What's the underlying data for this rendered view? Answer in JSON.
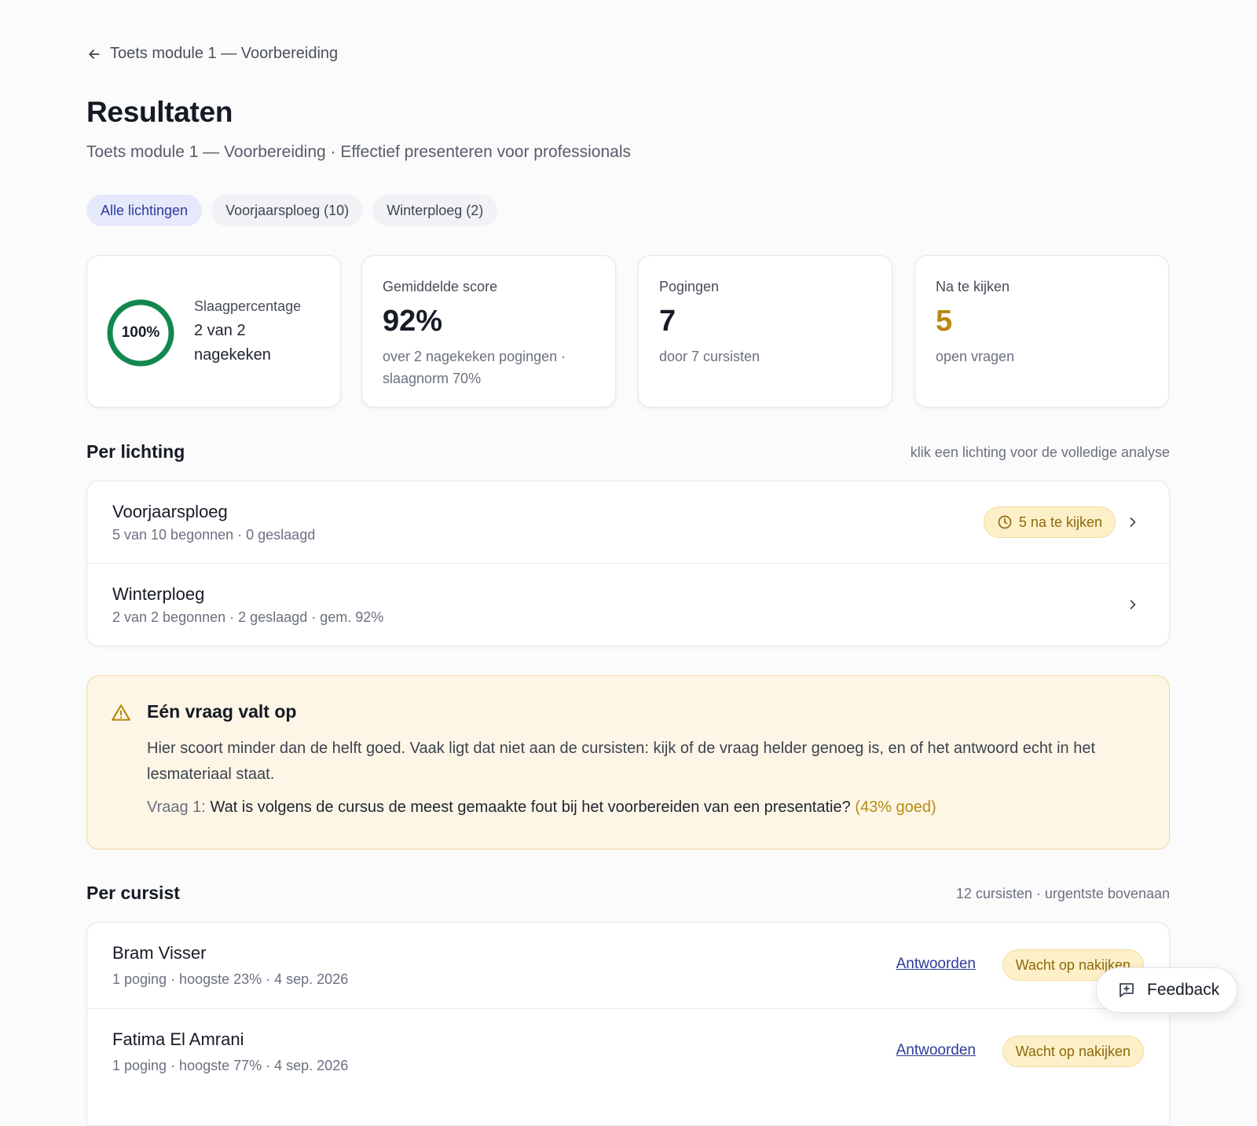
{
  "nav": {
    "back_label": "Toets module 1 — Voorbereiding"
  },
  "header": {
    "title": "Resultaten",
    "subtitle": "Toets module 1 — Voorbereiding · Effectief presenteren voor professionals"
  },
  "filters": [
    {
      "label": "Alle lichtingen",
      "active": true
    },
    {
      "label": "Voorjaarsploeg (10)",
      "active": false
    },
    {
      "label": "Winterploeg (2)",
      "active": false
    }
  ],
  "stats": {
    "pass": {
      "ring_label": "100%",
      "pass_fraction": 1.0,
      "label": "Slaagpercentage",
      "detail": "2 van 2 nagekeken"
    },
    "avg": {
      "label": "Gemiddelde score",
      "value": "92%",
      "desc": "over 2 nagekeken pogingen · slaagnorm 70%"
    },
    "attempts": {
      "label": "Pogingen",
      "value": "7",
      "desc": "door 7 cursisten"
    },
    "review": {
      "label": "Na te kijken",
      "value": "5",
      "desc": "open vragen"
    }
  },
  "cohorts": {
    "title": "Per lichting",
    "hint": "klik een lichting voor de volledige analyse",
    "items": [
      {
        "name": "Voorjaarsploeg",
        "meta": "5 van 10 begonnen · 0 geslaagd",
        "badge": "5 na te kijken"
      },
      {
        "name": "Winterploeg",
        "meta": "2 van 2 begonnen · 2 geslaagd · gem. 92%"
      }
    ]
  },
  "alert": {
    "title": "Eén vraag valt op",
    "body": "Hier scoort minder dan de helft goed. Vaak ligt dat niet aan de cursisten: kijk of de vraag helder genoeg is, en of het antwoord echt in het lesmateriaal staat.",
    "question_label": "Vraag 1:",
    "question_text": "Wat is volgens de cursus de meest gemaakte fout bij het voorbereiden van een presentatie?",
    "question_pct": "(43% goed)"
  },
  "students": {
    "title": "Per cursist",
    "hint": "12 cursisten · urgentste bovenaan",
    "items": [
      {
        "name": "Bram Visser",
        "meta": "1 poging · hoogste 23% · 4 sep. 2026",
        "link": "Antwoorden",
        "status": "Wacht op nakijken"
      },
      {
        "name": "Fatima El Amrani",
        "meta": "1 poging · hoogste 77% · 4 sep. 2026",
        "link": "Antwoorden",
        "status": "Wacht op nakijken"
      }
    ]
  },
  "feedback": {
    "label": "Feedback"
  },
  "colors": {
    "accent": "#2c3b9a",
    "success": "#12884f",
    "warning": "#b88a12",
    "warning_bg": "#fdf6e6"
  }
}
